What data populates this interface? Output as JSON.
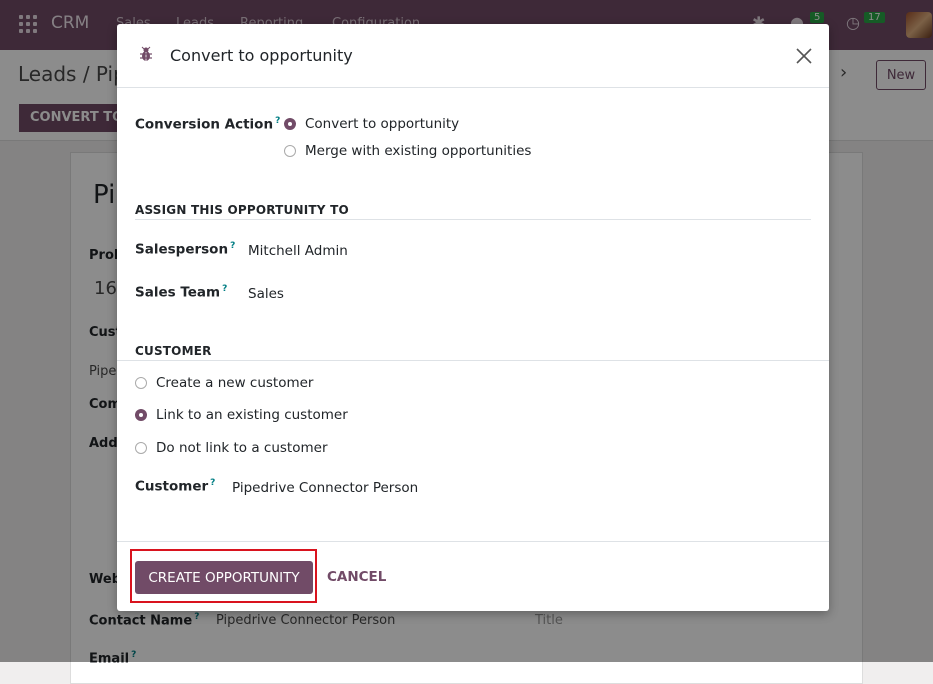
{
  "navbar": {
    "brand": "CRM",
    "menu": [
      "Sales",
      "Leads",
      "Reporting",
      "Configuration"
    ],
    "chat_count": "5",
    "activity_count": "17"
  },
  "control": {
    "breadcrumb": "Leads / Pip",
    "new_label": "New",
    "convert_label": "CONVERT TO"
  },
  "background_form": {
    "title": "Pi",
    "probability_label": "Prob",
    "probability_value": "16",
    "customer_label": "Cust",
    "customer_value": "Pipe",
    "company_label": "Com",
    "address_label": "Addr",
    "website_label": "Web",
    "contact_name_label": "Contact Name",
    "contact_name_value": "Pipedrive Connector Person",
    "title_label": "Title",
    "email_label": "Email",
    "help_mark": "?"
  },
  "modal": {
    "title": "Convert to opportunity",
    "conversion_action_label": "Conversion Action",
    "conversion_options": [
      "Convert to opportunity",
      "Merge with existing opportunities"
    ],
    "conversion_selected": 0,
    "assign_section": "ASSIGN THIS OPPORTUNITY TO",
    "salesperson_label": "Salesperson",
    "salesperson_value": "Mitchell Admin",
    "sales_team_label": "Sales Team",
    "sales_team_value": "Sales",
    "customer_section": "CUSTOMER",
    "customer_options": [
      "Create a new customer",
      "Link to an existing customer",
      "Do not link to a customer"
    ],
    "customer_selected": 1,
    "customer_label": "Customer",
    "customer_value": "Pipedrive Connector Person",
    "help_mark": "?",
    "create_label": "CREATE OPPORTUNITY",
    "cancel_label": "CANCEL"
  },
  "colors": {
    "brand": "#714b67",
    "highlight": "#d9131e",
    "help": "#017e84"
  }
}
